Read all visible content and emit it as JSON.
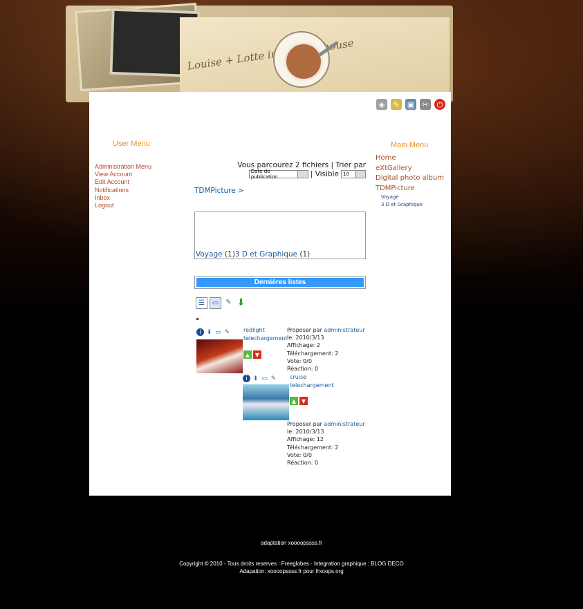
{
  "header_icons": [
    "cart-icon",
    "notepad-icon",
    "photo-icon",
    "tools-icon",
    "power-icon"
  ],
  "header": {
    "handwriting": "Louise + Lotte in front of house"
  },
  "user_menu": {
    "title": "User Menu",
    "items": [
      "Administration Menu",
      "View Account",
      "Edit Account",
      "Notifications",
      "Inbox",
      "Logout"
    ]
  },
  "main_menu": {
    "title": "Main Menu",
    "items": [
      "Home",
      "eXtGallery",
      "Digital photo album",
      "TDMPicture"
    ],
    "subitems": [
      "Voyage",
      "3 D et Graphique"
    ]
  },
  "browse": {
    "text": "Vous parcourez 2 fichiers | Trier par",
    "sort_value": "Date de publication",
    "sep_visible": "| Visible",
    "visible_value": "10"
  },
  "breadcrumb": {
    "link": "TDMPicture",
    "sep": ">"
  },
  "categories": [
    {
      "name": "Voyage",
      "count": "(1)"
    },
    {
      "name": "3 D et Graphique",
      "count": "(1)"
    }
  ],
  "latest": {
    "title": "Dernières listes"
  },
  "items": [
    {
      "title_line1": "redlight",
      "title_line2": "telechargement",
      "proposed_by": "Proposer par",
      "author": "administrateur",
      "date": "le: 2010/3/13",
      "views": "Affichage: 2",
      "downloads": "Téléchargement: 2",
      "vote": "Vote: 0/0",
      "reactions": "Réaction: 0"
    },
    {
      "title_line1": "cruise",
      "title_line2": "telechargement",
      "proposed_by": "Proposer par",
      "author": "administrateur",
      "date": "le: 2010/3/13",
      "views": "Affichage: 12",
      "downloads": "Téléchargement: 2",
      "vote": "Vote: 0/0",
      "reactions": "Réaction: 0"
    }
  ],
  "footer": {
    "line1": "adaptation xoooopssss.fr",
    "line2": "Copyright © 2010 - Tous droits reserves : Freeglobes - Integration graphique : BLOG DECO",
    "line3": "Adapation: xoooopssss.fr pour frxoops.org"
  }
}
